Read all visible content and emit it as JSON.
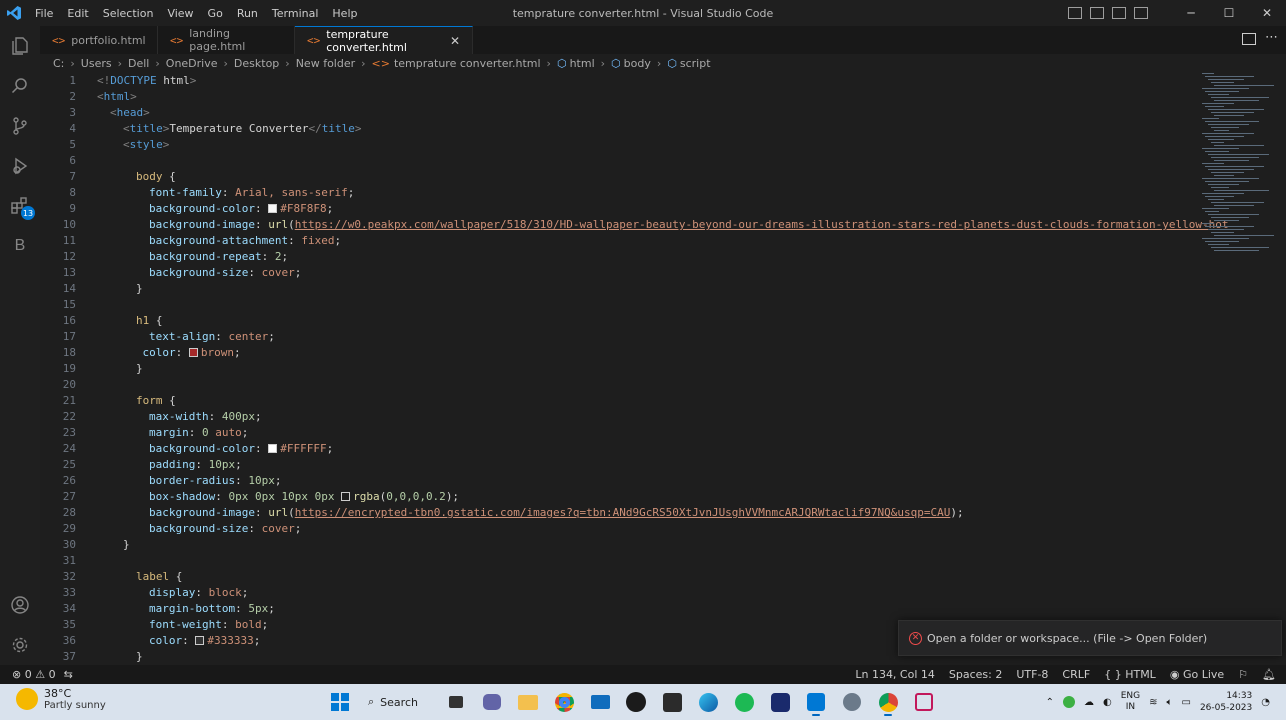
{
  "window": {
    "title": "temprature converter.html - Visual Studio Code",
    "menu": [
      "File",
      "Edit",
      "Selection",
      "View",
      "Go",
      "Run",
      "Terminal",
      "Help"
    ]
  },
  "activity_bar": {
    "items": [
      "explorer-icon",
      "search-icon",
      "source-control-icon",
      "run-debug-icon",
      "extensions-icon",
      "b-extension-icon"
    ],
    "extensions_badge": "13",
    "b_label": "B"
  },
  "tabs": [
    {
      "label": "portfolio.html",
      "active": false
    },
    {
      "label": "landing page.html",
      "active": false
    },
    {
      "label": "temprature converter.html",
      "active": true
    }
  ],
  "tab_close_glyph": "✕",
  "breadcrumb": [
    "C:",
    "Users",
    "Dell",
    "OneDrive",
    "Desktop",
    "New folder",
    "temprature converter.html",
    "html",
    "body",
    "script"
  ],
  "editor": {
    "lines": [
      {
        "n": "1",
        "indent": 0,
        "t": [
          [
            "punc",
            "<!"
          ],
          [
            "tag",
            "DOCTYPE"
          ],
          [
            "txt",
            " html"
          ],
          [
            "punc",
            ">"
          ]
        ]
      },
      {
        "n": "2",
        "indent": 0,
        "t": [
          [
            "punc",
            "<"
          ],
          [
            "tag",
            "html"
          ],
          [
            "punc",
            ">"
          ]
        ]
      },
      {
        "n": "3",
        "indent": 1,
        "t": [
          [
            "punc",
            "<"
          ],
          [
            "tag",
            "head"
          ],
          [
            "punc",
            ">"
          ]
        ]
      },
      {
        "n": "4",
        "indent": 2,
        "t": [
          [
            "punc",
            "<"
          ],
          [
            "tag",
            "title"
          ],
          [
            "punc",
            ">"
          ],
          [
            "txt",
            "Temperature Converter"
          ],
          [
            "punc",
            "</"
          ],
          [
            "tag",
            "title"
          ],
          [
            "punc",
            ">"
          ]
        ]
      },
      {
        "n": "5",
        "indent": 2,
        "t": [
          [
            "punc",
            "<"
          ],
          [
            "tag",
            "style"
          ],
          [
            "punc",
            ">"
          ]
        ]
      },
      {
        "n": "6",
        "indent": 0,
        "t": []
      },
      {
        "n": "7",
        "indent": 3,
        "t": [
          [
            "sel",
            "body"
          ],
          [
            "txt",
            " {"
          ]
        ]
      },
      {
        "n": "8",
        "indent": 4,
        "t": [
          [
            "prop",
            "font-family"
          ],
          [
            "txt",
            ": "
          ],
          [
            "val",
            "Arial, sans-serif"
          ],
          [
            "txt",
            ";"
          ]
        ]
      },
      {
        "n": "9",
        "indent": 4,
        "t": [
          [
            "prop",
            "background-color"
          ],
          [
            "txt",
            ": "
          ],
          [
            "sw",
            "#F8F8F8"
          ],
          [
            "val",
            "#F8F8F8"
          ],
          [
            "txt",
            ";"
          ]
        ]
      },
      {
        "n": "10",
        "indent": 4,
        "t": [
          [
            "prop",
            "background-image"
          ],
          [
            "txt",
            ": "
          ],
          [
            "fn",
            "url"
          ],
          [
            "txt",
            "("
          ],
          [
            "url",
            "https://w0.peakpx.com/wallpaper/518/310/HD-wallpaper-beauty-beyond-our-dreams-illustration-stars-red-planets-dust-clouds-formation-yellow-hot"
          ]
        ]
      },
      {
        "n": "11",
        "indent": 4,
        "t": [
          [
            "prop",
            "background-attachment"
          ],
          [
            "txt",
            ": "
          ],
          [
            "val",
            "fixed"
          ],
          [
            "txt",
            ";"
          ]
        ]
      },
      {
        "n": "12",
        "indent": 4,
        "t": [
          [
            "prop",
            "background-repeat"
          ],
          [
            "txt",
            ": "
          ],
          [
            "num",
            "2"
          ],
          [
            "txt",
            ";"
          ]
        ]
      },
      {
        "n": "13",
        "indent": 4,
        "t": [
          [
            "prop",
            "background-size"
          ],
          [
            "txt",
            ": "
          ],
          [
            "val",
            "cover"
          ],
          [
            "txt",
            ";"
          ]
        ]
      },
      {
        "n": "14",
        "indent": 3,
        "t": [
          [
            "txt",
            "}"
          ]
        ]
      },
      {
        "n": "15",
        "indent": 0,
        "t": []
      },
      {
        "n": "16",
        "indent": 3,
        "t": [
          [
            "sel",
            "h1"
          ],
          [
            "txt",
            " {"
          ]
        ]
      },
      {
        "n": "17",
        "indent": 4,
        "t": [
          [
            "prop",
            "text-align"
          ],
          [
            "txt",
            ": "
          ],
          [
            "val",
            "center"
          ],
          [
            "txt",
            ";"
          ]
        ]
      },
      {
        "n": "18",
        "indent": 3.5,
        "t": [
          [
            "prop",
            "color"
          ],
          [
            "txt",
            ": "
          ],
          [
            "sw",
            "#a52a2a"
          ],
          [
            "val",
            "brown"
          ],
          [
            "txt",
            ";"
          ]
        ]
      },
      {
        "n": "19",
        "indent": 3,
        "t": [
          [
            "txt",
            "}"
          ]
        ]
      },
      {
        "n": "20",
        "indent": 0,
        "t": []
      },
      {
        "n": "21",
        "indent": 3,
        "t": [
          [
            "sel",
            "form"
          ],
          [
            "txt",
            " {"
          ]
        ]
      },
      {
        "n": "22",
        "indent": 4,
        "t": [
          [
            "prop",
            "max-width"
          ],
          [
            "txt",
            ": "
          ],
          [
            "num",
            "400px"
          ],
          [
            "txt",
            ";"
          ]
        ]
      },
      {
        "n": "23",
        "indent": 4,
        "t": [
          [
            "prop",
            "margin"
          ],
          [
            "txt",
            ": "
          ],
          [
            "num",
            "0"
          ],
          [
            "txt",
            " "
          ],
          [
            "val",
            "auto"
          ],
          [
            "txt",
            ";"
          ]
        ]
      },
      {
        "n": "24",
        "indent": 4,
        "t": [
          [
            "prop",
            "background-color"
          ],
          [
            "txt",
            ": "
          ],
          [
            "sw",
            "#FFFFFF"
          ],
          [
            "val",
            "#FFFFFF"
          ],
          [
            "txt",
            ";"
          ]
        ]
      },
      {
        "n": "25",
        "indent": 4,
        "t": [
          [
            "prop",
            "padding"
          ],
          [
            "txt",
            ": "
          ],
          [
            "num",
            "10px"
          ],
          [
            "txt",
            ";"
          ]
        ]
      },
      {
        "n": "26",
        "indent": 4,
        "t": [
          [
            "prop",
            "border-radius"
          ],
          [
            "txt",
            ": "
          ],
          [
            "num",
            "10px"
          ],
          [
            "txt",
            ";"
          ]
        ]
      },
      {
        "n": "27",
        "indent": 4,
        "t": [
          [
            "prop",
            "box-shadow"
          ],
          [
            "txt",
            ": "
          ],
          [
            "num",
            "0px 0px 10px 0px"
          ],
          [
            "txt",
            " "
          ],
          [
            "sw",
            "#1e1e1e"
          ],
          [
            "fn",
            "rgba"
          ],
          [
            "txt",
            "("
          ],
          [
            "num",
            "0,0,0,0.2"
          ],
          [
            "txt",
            ");"
          ]
        ]
      },
      {
        "n": "28",
        "indent": 4,
        "t": [
          [
            "prop",
            "background-image"
          ],
          [
            "txt",
            ": "
          ],
          [
            "fn",
            "url"
          ],
          [
            "txt",
            "("
          ],
          [
            "url",
            "https://encrypted-tbn0.gstatic.com/images?q=tbn:ANd9GcRS50XtJvnJUsghVVMnmcARJQRWtaclif97NQ&usqp=CAU"
          ],
          [
            "txt",
            ");"
          ]
        ]
      },
      {
        "n": "29",
        "indent": 4,
        "t": [
          [
            "prop",
            "background-size"
          ],
          [
            "txt",
            ": "
          ],
          [
            "val",
            "cover"
          ],
          [
            "txt",
            ";"
          ]
        ]
      },
      {
        "n": "30",
        "indent": 2,
        "t": [
          [
            "txt",
            "}"
          ]
        ]
      },
      {
        "n": "31",
        "indent": 0,
        "t": []
      },
      {
        "n": "32",
        "indent": 3,
        "t": [
          [
            "sel",
            "label"
          ],
          [
            "txt",
            " {"
          ]
        ]
      },
      {
        "n": "33",
        "indent": 4,
        "t": [
          [
            "prop",
            "display"
          ],
          [
            "txt",
            ": "
          ],
          [
            "val",
            "block"
          ],
          [
            "txt",
            ";"
          ]
        ]
      },
      {
        "n": "34",
        "indent": 4,
        "t": [
          [
            "prop",
            "margin-bottom"
          ],
          [
            "txt",
            ": "
          ],
          [
            "num",
            "5px"
          ],
          [
            "txt",
            ";"
          ]
        ]
      },
      {
        "n": "35",
        "indent": 4,
        "t": [
          [
            "prop",
            "font-weight"
          ],
          [
            "txt",
            ": "
          ],
          [
            "val",
            "bold"
          ],
          [
            "txt",
            ";"
          ]
        ]
      },
      {
        "n": "36",
        "indent": 4,
        "t": [
          [
            "prop",
            "color"
          ],
          [
            "txt",
            ": "
          ],
          [
            "sw",
            "#333333"
          ],
          [
            "val",
            "#333333"
          ],
          [
            "txt",
            ";"
          ]
        ]
      },
      {
        "n": "37",
        "indent": 3,
        "t": [
          [
            "txt",
            "}"
          ]
        ]
      }
    ]
  },
  "notification": {
    "text": "Open a folder or workspace... (File -> Open Folder)",
    "icon": "error-circle-icon"
  },
  "status_bar": {
    "errors": "0",
    "warnings": "0",
    "position": "Ln 134, Col 14",
    "spaces": "Spaces: 2",
    "encoding": "UTF-8",
    "eol": "CRLF",
    "language": "HTML",
    "go_live": "Go Live"
  },
  "taskbar": {
    "weather_temp": "38°C",
    "weather_cond": "Partly sunny",
    "search_label": "Search",
    "lang_top": "ENG",
    "lang_bottom": "IN",
    "time": "14:33",
    "date": "26-05-2023"
  },
  "colors": {
    "accent": "#0078d4",
    "editor_bg": "#1e1e1e",
    "taskbar_bg": "#d9e2ed"
  }
}
